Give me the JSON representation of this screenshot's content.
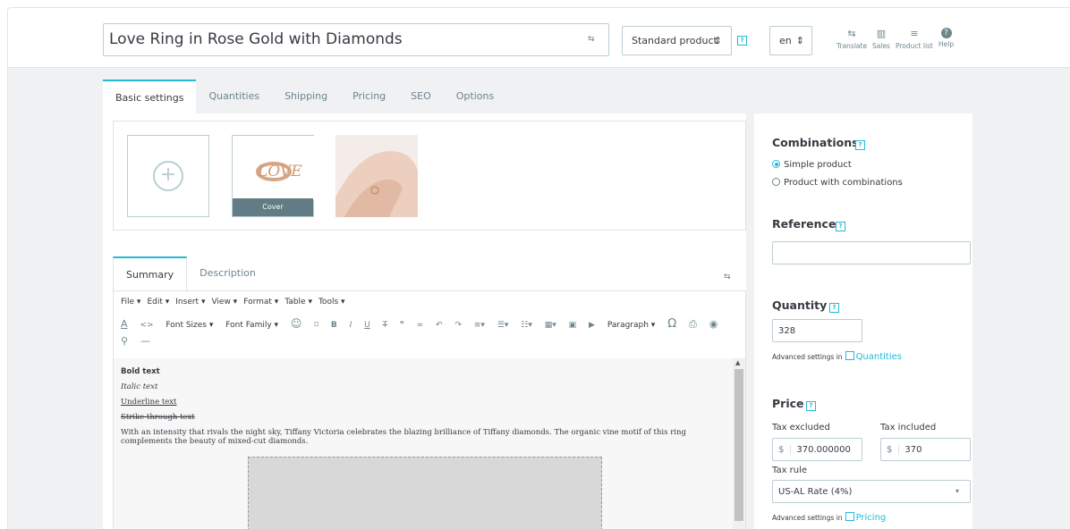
{
  "header": {
    "product_name": "Love Ring in Rose Gold with Diamonds",
    "product_type": "Standard product",
    "language": "en",
    "tools": [
      {
        "label": "Translate",
        "icon": "translate-icon"
      },
      {
        "label": "Sales",
        "icon": "sales-chart-icon"
      },
      {
        "label": "Product list",
        "icon": "list-icon"
      },
      {
        "label": "Help",
        "icon": "help-icon"
      }
    ]
  },
  "tabs": [
    "Basic settings",
    "Quantities",
    "Shipping",
    "Pricing",
    "SEO",
    "Options"
  ],
  "images": {
    "cover_label": "Cover"
  },
  "editor": {
    "tabs": [
      "Summary",
      "Description"
    ],
    "menu": [
      "File ▾",
      "Edit ▾",
      "Insert ▾",
      "View ▾",
      "Format ▾",
      "Table ▾",
      "Tools ▾"
    ],
    "toolbar_font_sizes": "Font Sizes ▾",
    "toolbar_font_family": "Font Family ▾",
    "toolbar_paragraph": "Paragraph ▾",
    "content": {
      "bold": "Bold text",
      "italic": "Italic text",
      "underline": "Underline text",
      "strike": "Strike through text",
      "paragraph": "With an intensity that rivals the night sky, Tiffany Victoria celebrates the blazing brilliance of Tiffany diamonds. The organic vine motif of this ring complements the beauty of mixed-cut diamonds."
    }
  },
  "right": {
    "combinations_title": "Combinations",
    "simple_product": "Simple product",
    "product_with_combinations": "Product with combinations",
    "reference_title": "Reference",
    "reference_value": "",
    "quantity_title": "Quantity",
    "quantity_value": "328",
    "advanced_settings_in": "Advanced settings in",
    "quantities_link": "Quantities",
    "price_title": "Price",
    "tax_excluded_label": "Tax excluded",
    "tax_included_label": "Tax included",
    "currency": "$",
    "tax_excluded_value": "370.000000",
    "tax_included_value": "370",
    "tax_rule_label": "Tax rule",
    "tax_rule_value": "US-AL Rate (4%)",
    "pricing_link": "Pricing"
  },
  "colors": {
    "accent": "#25b9d7",
    "text": "#363a41",
    "muted": "#6c868e",
    "cover_bg": "#617c85"
  }
}
